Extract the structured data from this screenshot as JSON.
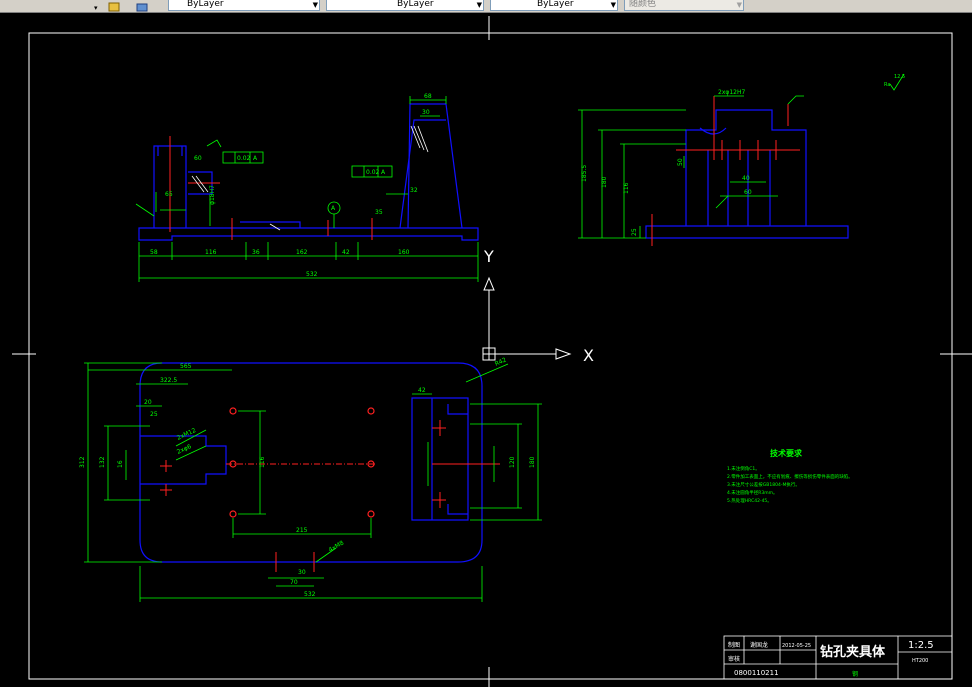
{
  "toolbar": {
    "layer_color": "ByLayer",
    "layer_linetype": "ByLayer",
    "layer_lineweight": "ByLayer",
    "plot_style": "随颜色"
  },
  "colors": {
    "background": "#000000",
    "outline": "#1010ff",
    "dimension": "#00ff00",
    "centerline": "#ff2020",
    "text": "#ffffff",
    "title_text": "#ffffff",
    "label_text": "#00ff00"
  },
  "ucs": {
    "x_label": "X",
    "y_label": "Y"
  },
  "front_view": {
    "dims": [
      "58",
      "116",
      "36",
      "162",
      "42",
      "160",
      "532",
      "68",
      "30",
      "32",
      "65",
      "60",
      "35"
    ],
    "datum": "A",
    "tol_perp": "0.02",
    "tol_flat": "0.02",
    "tol_ref": "A",
    "hole_dim": "φ18H7"
  },
  "side_view": {
    "dims": [
      "185.5",
      "180",
      "116",
      "40",
      "60",
      "50",
      "25",
      "2xφ12H7"
    ]
  },
  "top_view": {
    "dims": [
      "565",
      "322.5",
      "20",
      "25",
      "42",
      "312",
      "132",
      "16",
      "116",
      "215",
      "70",
      "30",
      "532",
      "180",
      "120",
      "R42",
      "2xM12",
      "2xφ6",
      "4xM8"
    ]
  },
  "roughness": {
    "general": "12.5",
    "note": "Ra"
  },
  "tech_requirements": {
    "title": "技术要求",
    "items": [
      "1.未注倒角C1。",
      "2.零件加工表面上，不应有划痕、擦伤等损伤零件表面的缺陷。",
      "3.未注尺寸公差按GB1804-M执行。",
      "4.未注圆角半径R3mm。",
      "5.热处理HRC42-45。"
    ]
  },
  "title_block": {
    "name": "钻孔夹具体",
    "scale": "1:2.5",
    "designer_label": "制图",
    "designer": "谢国龙",
    "date": "2012-05-25",
    "checker_label": "审核",
    "drawing_no": "0800110211",
    "material": "HT200",
    "sheet": "钢"
  }
}
